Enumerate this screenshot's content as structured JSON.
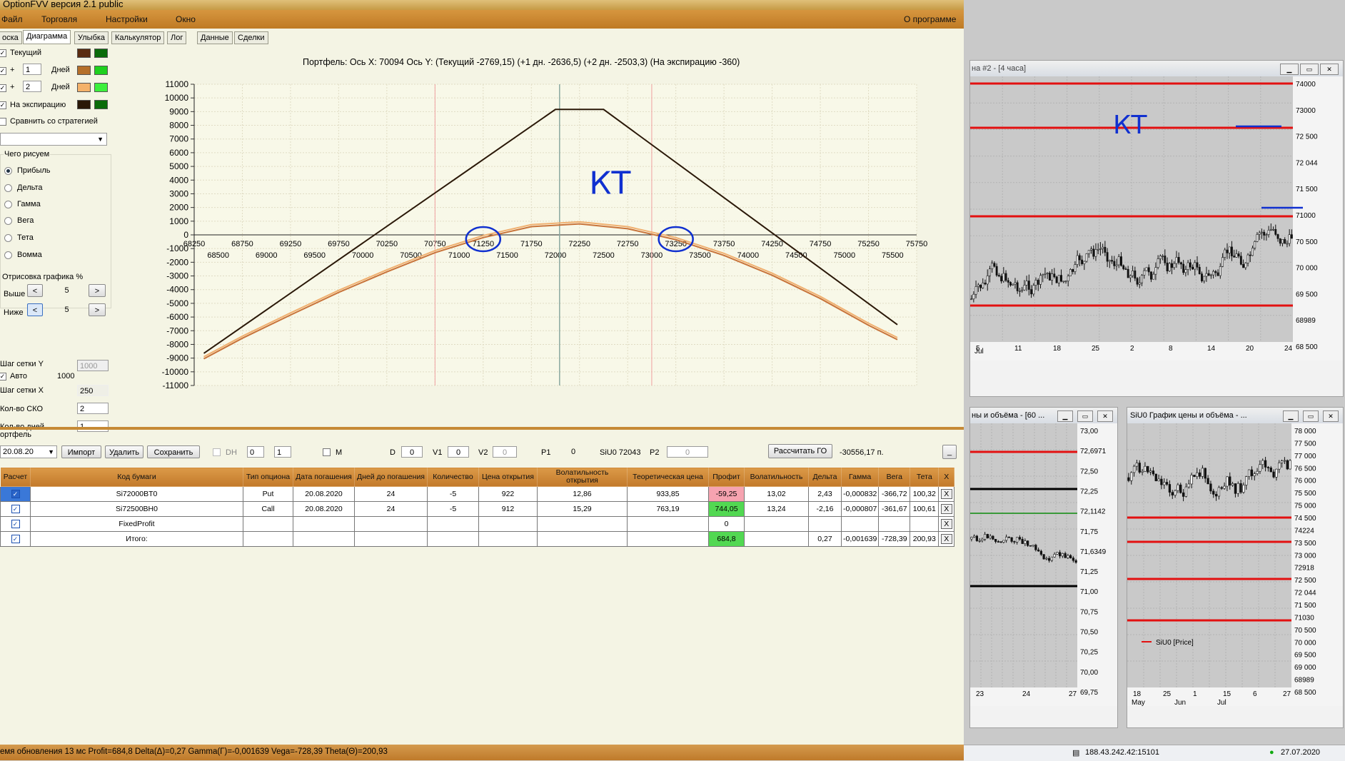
{
  "app": {
    "title": "OptionFVV версия 2.1 public",
    "menu": [
      "Файл",
      "Торговля",
      "Настройки",
      "Окно"
    ],
    "about": "О программе"
  },
  "tabs": [
    "оска",
    "Диаграмма",
    "Улыбка",
    "Калькулятор",
    "Лог",
    "Данные",
    "Сделки"
  ],
  "left_panel": {
    "series_rows": [
      {
        "label": "Текущий",
        "checked": true,
        "color1": "#5a2c10",
        "color2": "#0a6b0a"
      },
      {
        "plus": "+",
        "value": "1",
        "unit": "Дней",
        "checked": true,
        "color1": "#b5702a",
        "color2": "#1fd01f"
      },
      {
        "plus": "+",
        "value": "2",
        "unit": "Дней",
        "checked": true,
        "color1": "#f4b26a",
        "color2": "#3cf03c"
      },
      {
        "label": "На экспирацию",
        "checked": true,
        "color1": "#2a1808",
        "color2": "#0a6b0a"
      }
    ],
    "compare_label": "Сравнить со стратегией",
    "draw_group_label": "Чего рисуем",
    "draw_options": [
      "Прибыль",
      "Дельта",
      "Гамма",
      "Вега",
      "Тета",
      "Вомма"
    ],
    "draw_selected": 0,
    "render_group_label": "Отрисовка графика %",
    "above_label": "Выше",
    "above_value": "5",
    "below_label": "Ниже",
    "below_value": "5",
    "grid_y_label": "Шаг сетки Y",
    "grid_y_value": "1000",
    "auto_label": "Авто",
    "auto_value": "1000",
    "grid_x_label": "Шаг сетки X",
    "grid_x_value": "250",
    "sko_label": "Кол-во СКО",
    "sko_value": "2",
    "days_label": "Кол-во дней",
    "days_value": "1",
    "prev_symbol": "<",
    "next_symbol": ">"
  },
  "chart_header": "Портфель: Ось X: 70094 Ось Y:  (Текущий -2769,15)  (+1 дн. -2636,5)  (+2 дн. -2503,3)  (На экспирацию -360)",
  "chart_annotation": "КТ",
  "chart_data": {
    "type": "line",
    "title": "",
    "xlabel": "",
    "ylabel": "",
    "ylim": [
      -11000,
      11000
    ],
    "xlim": [
      68250,
      75750
    ],
    "y_ticks": [
      11000,
      10000,
      9000,
      8000,
      7000,
      6000,
      5000,
      4000,
      3000,
      2000,
      1000,
      0,
      -1000,
      -2000,
      -3000,
      -4000,
      -5000,
      -6000,
      -7000,
      -8000,
      -9000,
      -10000,
      -11000
    ],
    "x_ticks_upper": [
      68250,
      68750,
      69250,
      69750,
      70250,
      70750,
      71250,
      71750,
      72250,
      72750,
      73250,
      73750,
      74250,
      74750,
      75250,
      75750
    ],
    "x_ticks_lower": [
      68500,
      69000,
      69500,
      70000,
      70500,
      71000,
      71500,
      72000,
      72500,
      73000,
      73500,
      74000,
      74500,
      75000,
      75500
    ],
    "red_verticals": [
      70750,
      73000
    ],
    "current_price": 72043,
    "circled_ticks": [
      71250,
      73250
    ],
    "series": [
      {
        "name": "На экспирацию",
        "color": "#2a1808",
        "x": [
          68350,
          72000,
          72500,
          75550
        ],
        "y": [
          -8650,
          9160,
          9160,
          -6560
        ]
      },
      {
        "name": "Текущий",
        "color": "#c8743a",
        "x": [
          68350,
          68750,
          69250,
          69750,
          70250,
          70750,
          71250,
          71750,
          72250,
          72750,
          73250,
          73750,
          74250,
          74750,
          75250,
          75550
        ],
        "y": [
          -9050,
          -7550,
          -5850,
          -4200,
          -2700,
          -1300,
          -200,
          600,
          800,
          450,
          -350,
          -1500,
          -2950,
          -4650,
          -6600,
          -7650
        ]
      },
      {
        "name": "+1 дн.",
        "color": "#f0b070",
        "x": [
          68350,
          68750,
          69250,
          69750,
          70250,
          70750,
          71250,
          71750,
          72250,
          72750,
          73250,
          73750,
          74250,
          74750,
          75250,
          75550
        ],
        "y": [
          -8900,
          -7400,
          -5700,
          -4050,
          -2550,
          -1150,
          -50,
          750,
          950,
          600,
          -200,
          -1350,
          -2800,
          -4500,
          -6450,
          -7500
        ]
      }
    ]
  },
  "portfolio": {
    "label": "ортфель",
    "date": "20.08.20",
    "buttons": [
      "Импорт",
      "Удалить",
      "Сохранить"
    ],
    "dh_label": "DH",
    "dh_value1": "0",
    "dh_value2": "1",
    "m_label": "M",
    "d_label": "D",
    "d_value": "0",
    "v1_label": "V1",
    "v1_value": "0",
    "v2_label": "V2",
    "v2_value": "0",
    "p1_label": "P1",
    "p1_value": "0",
    "si_label": "SiU0 72043",
    "p2_label": "P2",
    "p2_value": "0",
    "calc_button": "Рассчитать ГО",
    "go_value": "-30556,17 п.",
    "min_button": "_",
    "columns": [
      "Расчет",
      "Код бумаги",
      "Тип опциона",
      "Дата погашения",
      "Дней до погашения",
      "Количество",
      "Цена открытия",
      "Волатильность открытия",
      "Теоретическая цена",
      "Профит",
      "Волатильность",
      "Дельта",
      "Гамма",
      "Вега",
      "Тета",
      "X"
    ],
    "rows": [
      [
        "",
        "Si72000BT0",
        "Put",
        "20.08.2020",
        "24",
        "-5",
        "922",
        "12,86",
        "933,85",
        "-59,25",
        "13,02",
        "2,43",
        "-0,000832",
        "-366,72",
        "100,32",
        "X"
      ],
      [
        "",
        "Si72500BH0",
        "Call",
        "20.08.2020",
        "24",
        "-5",
        "912",
        "15,29",
        "763,19",
        "744,05",
        "13,24",
        "-2,16",
        "-0,000807",
        "-361,67",
        "100,61",
        "X"
      ],
      [
        "",
        "FixedProfit",
        "",
        "",
        "",
        "",
        "",
        "",
        "",
        "0",
        "",
        "",
        "",
        "",
        "",
        "X"
      ],
      [
        "",
        "Итого:",
        "",
        "",
        "",
        "",
        "",
        "",
        "",
        "684,8",
        "",
        "0,27",
        "-0,001639",
        "-728,39",
        "200,93",
        "X"
      ]
    ]
  },
  "status": "емя обновления 13 мс  Profit=684,8 Delta(Δ)=0,27 Gamma(Γ)=-0,001639 Vega=-728,39 Theta(Θ)=200,93",
  "right_windows": {
    "top": {
      "title": "на #2 - [4 часа]",
      "annotation": "КТ",
      "y_labels": [
        "74000",
        "73000",
        "72 500",
        "72 044",
        "71 500",
        "71000",
        "70 500",
        "70 000",
        "69 500",
        "68989",
        "68 500"
      ],
      "x_labels": [
        "5",
        "11",
        "18",
        "25",
        "2",
        "8",
        "14",
        "20",
        "24"
      ],
      "month_label": "Jul"
    },
    "bottom_left": {
      "title": "ны и объёма - [60 ...",
      "y_labels": [
        "73,00",
        "72,6971",
        "72,50",
        "72,25",
        "72,1142",
        "71,75",
        "71,6349",
        "71,25",
        "71,00",
        "70,75",
        "70,50",
        "70,25",
        "70,00",
        "69,75"
      ],
      "x_labels": [
        "23",
        "24",
        "27"
      ]
    },
    "bottom_right": {
      "title": "SiU0 График цены и объёма - ...",
      "legend": "SiU0 [Price]",
      "y_labels": [
        "78 000",
        "77 500",
        "77 000",
        "76 500",
        "76 000",
        "75 500",
        "75 000",
        "74 500",
        "74224",
        "73 500",
        "73 000",
        "72918",
        "72 500",
        "72 044",
        "71 500",
        "71030",
        "70 500",
        "70 000",
        "69 500",
        "69 000",
        "68989",
        "68 500"
      ],
      "x_labels": [
        "18",
        "25",
        "1",
        "15",
        "6",
        "27"
      ],
      "months": [
        "May",
        "Jun",
        "Jul"
      ]
    }
  },
  "taskbar": {
    "ip": "188.43.242.42:15101",
    "date": "27.07.2020"
  },
  "colors": {
    "accent": "#c68a36",
    "red_level": "#e31010",
    "annotation": "#1030d0",
    "profit_negative_bg": "#f6a3b0",
    "profit_positive_bg": "#52d852",
    "checkbox_blue": "#1a4fb0"
  }
}
